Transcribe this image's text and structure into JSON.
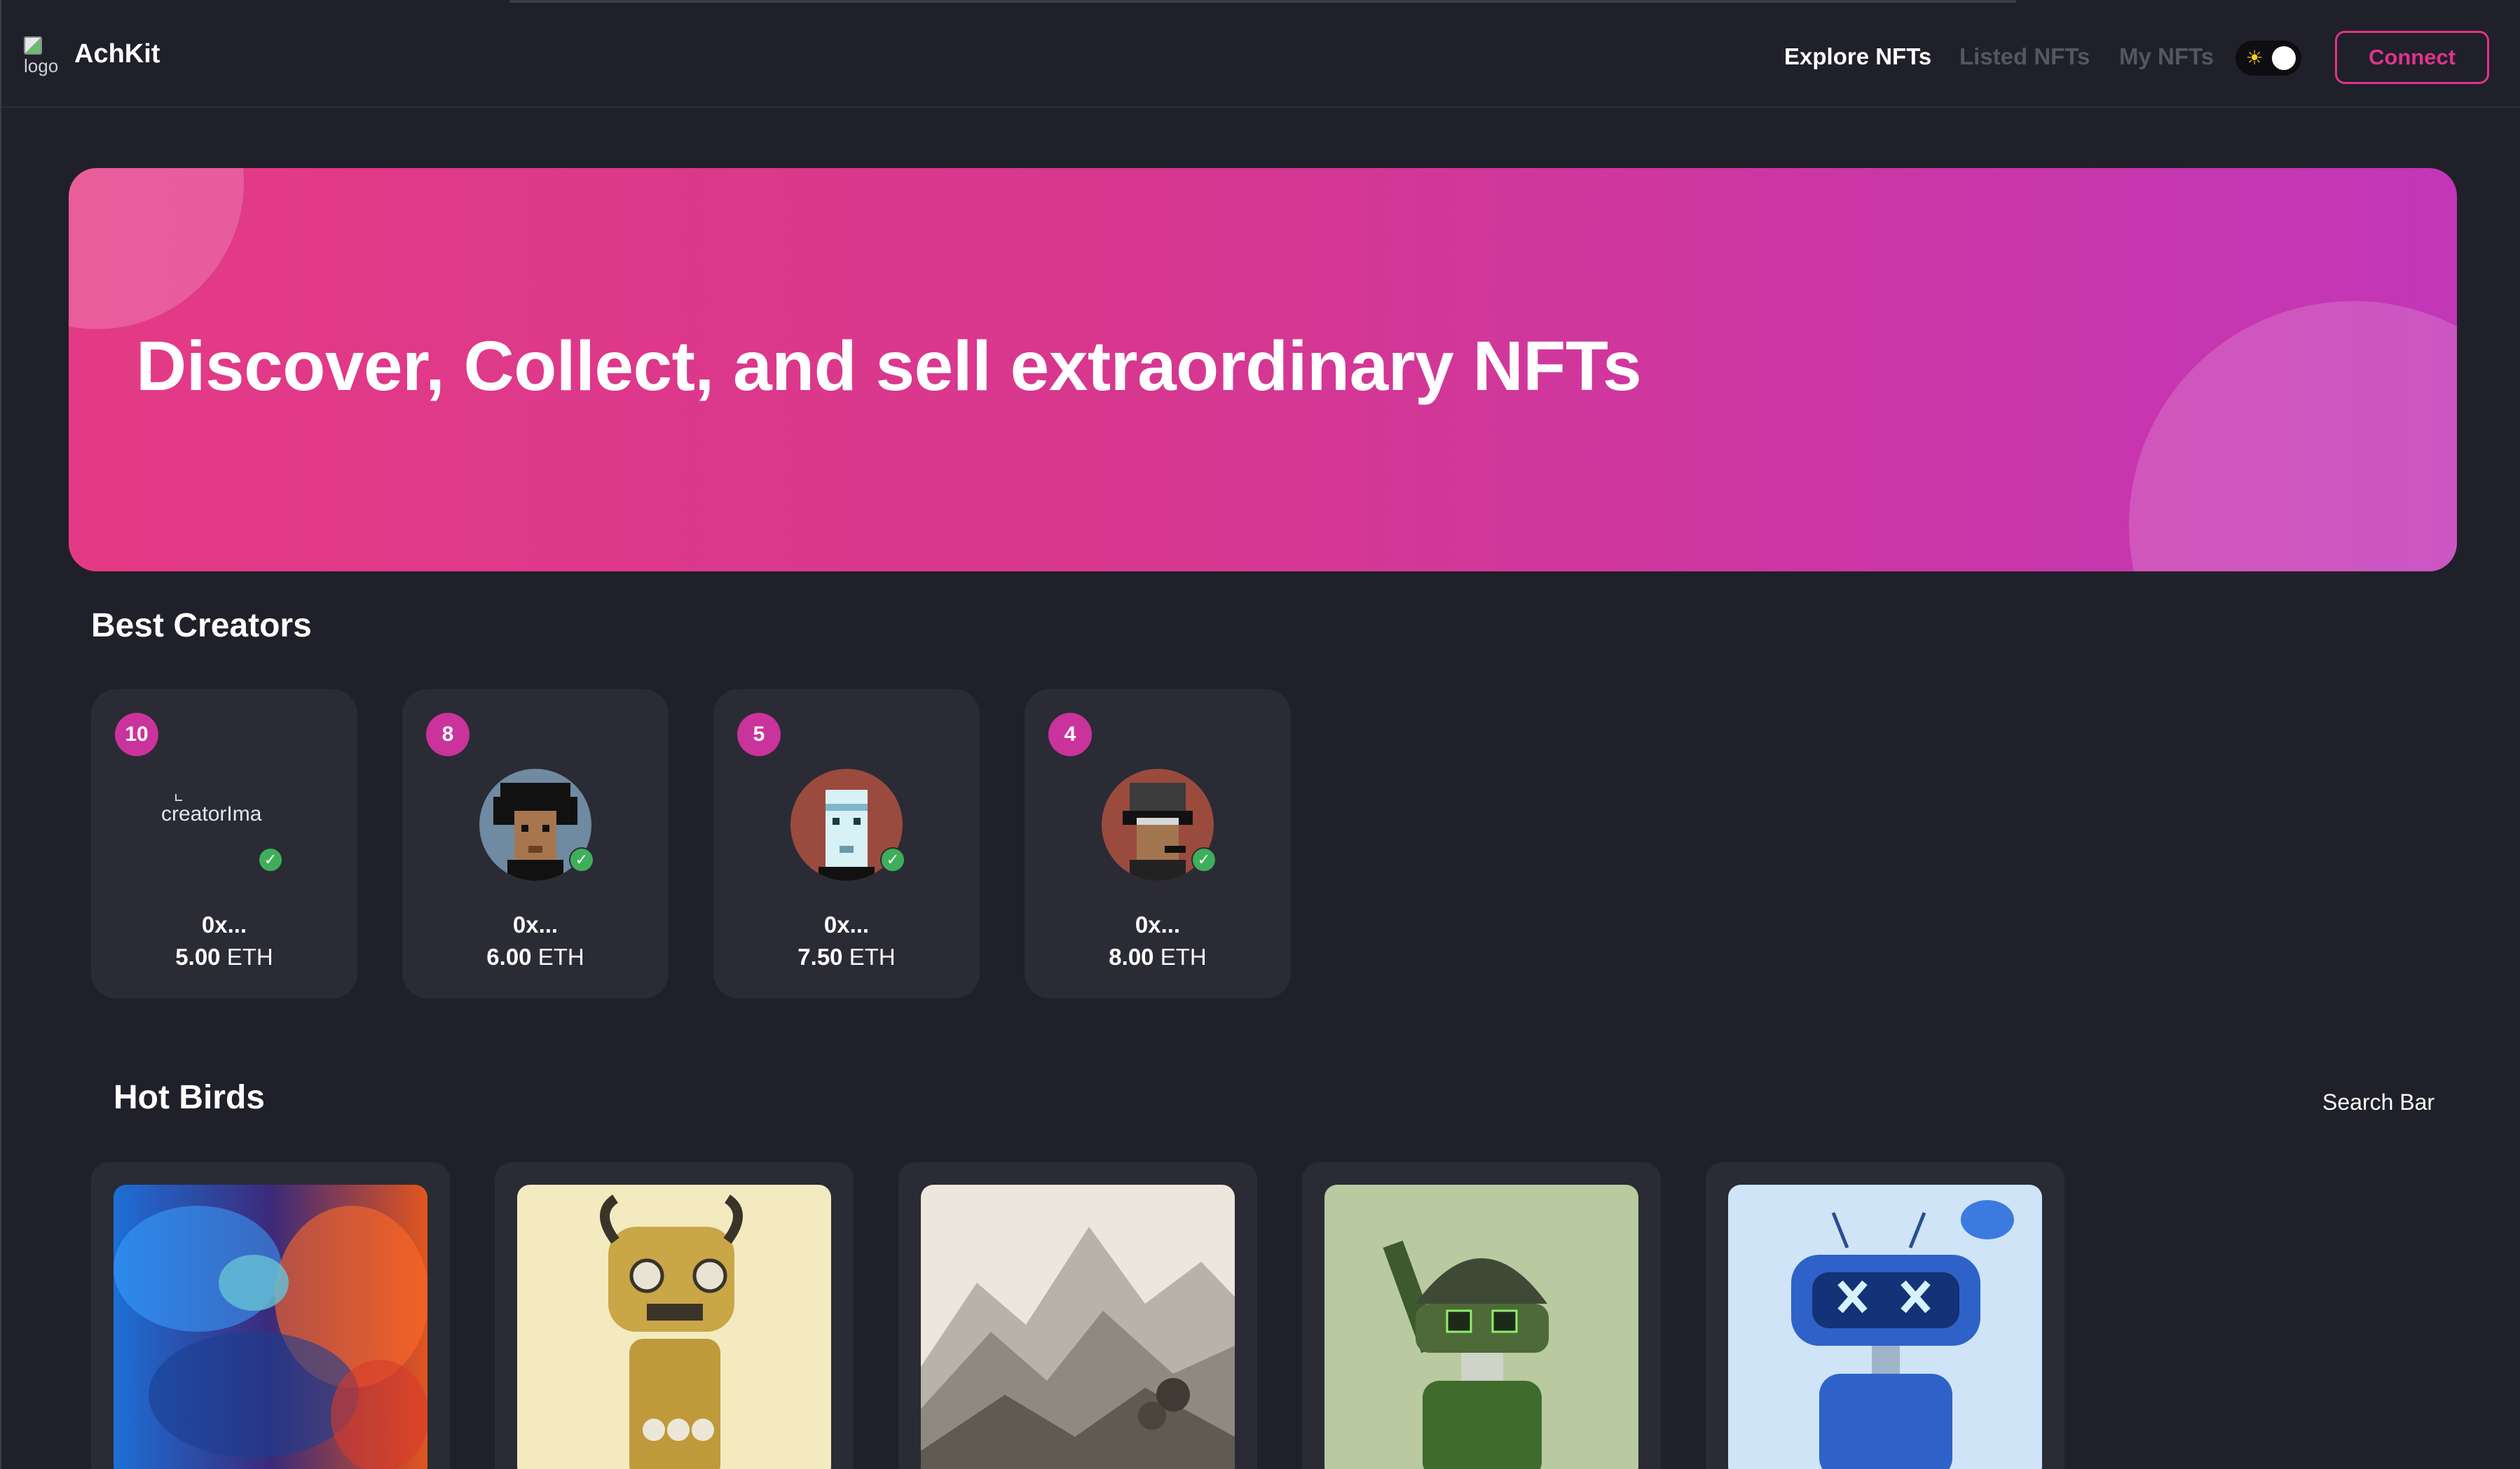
{
  "app": {
    "brand": "AchKit",
    "logo_alt": "logo"
  },
  "nav": {
    "explore": "Explore NFTs",
    "listed": "Listed NFTs",
    "mine": "My NFTs",
    "connect": "Connect"
  },
  "hero": {
    "title": "Discover, Collect, and sell extraordinary NFTs"
  },
  "best_creators": {
    "title": "Best Creators",
    "items": [
      {
        "rank": "10",
        "image_alt": "creatorIma",
        "address": "0x...",
        "amount": "5.00",
        "unit": "ETH"
      },
      {
        "rank": "8",
        "image_alt": "",
        "address": "0x...",
        "amount": "6.00",
        "unit": "ETH"
      },
      {
        "rank": "5",
        "image_alt": "",
        "address": "0x...",
        "amount": "7.50",
        "unit": "ETH"
      },
      {
        "rank": "4",
        "image_alt": "",
        "address": "0x...",
        "amount": "8.00",
        "unit": "ETH"
      }
    ]
  },
  "hot_birds": {
    "title": "Hot Birds",
    "search_label": "Search Bar"
  },
  "colors": {
    "background": "#1f2029",
    "card": "#2a2b35",
    "accent": "#e0338a",
    "badge": "#c9339b",
    "verified": "#3fae5a"
  }
}
